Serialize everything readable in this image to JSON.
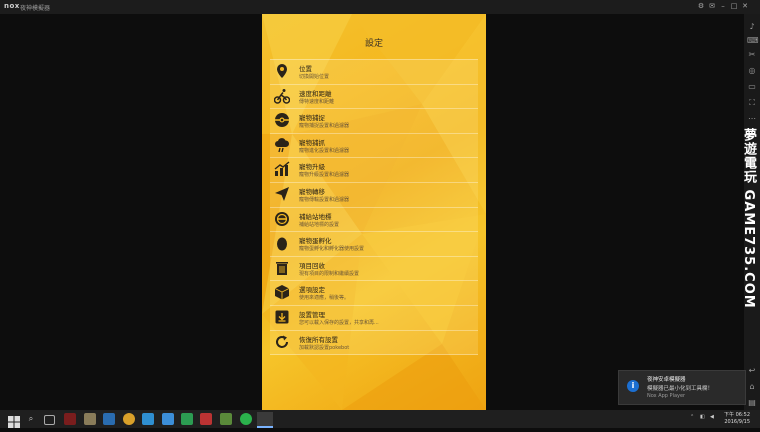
{
  "window": {
    "logo": "nox",
    "title": "夜神模擬器"
  },
  "settings": {
    "title": "設定",
    "items": [
      {
        "title": "位置",
        "subtitle": "切換開始位置",
        "icon": "map-pin-icon"
      },
      {
        "title": "速度和距離",
        "subtitle": "傳特速度和距離",
        "icon": "cyclist-icon"
      },
      {
        "title": "寵物捕捉",
        "subtitle": "寵物捕捉設置和過濾器",
        "icon": "pokeball-icon"
      },
      {
        "title": "寵物捕抓",
        "subtitle": "寵物進化設置和過濾器",
        "icon": "cloud-icon"
      },
      {
        "title": "寵物升級",
        "subtitle": "寵物升級設置和過濾器",
        "icon": "trend-up-icon"
      },
      {
        "title": "寵物轉移",
        "subtitle": "寵物傳輸設置和過濾器",
        "icon": "paper-plane-icon"
      },
      {
        "title": "補給站地標",
        "subtitle": "補給站地標的設置",
        "icon": "pokestop-icon"
      },
      {
        "title": "寵物蛋孵化",
        "subtitle": "寵物蛋孵化和孵化器使用設置",
        "icon": "egg-icon"
      },
      {
        "title": "項目回收",
        "subtitle": "現有項目的限制和繼續設置",
        "icon": "trash-icon"
      },
      {
        "title": "選項設定",
        "subtitle": "使用來適應，稍後等。",
        "icon": "box-icon"
      },
      {
        "title": "設置管理",
        "subtitle": "您可以載入保存的設置，共享和再...",
        "icon": "download-icon"
      },
      {
        "title": "恢復所有設置",
        "subtitle": "加載默認設置pokebot",
        "icon": "refresh-icon"
      }
    ]
  },
  "watermark": "夢遊電玩 GAME735.COM",
  "notification": {
    "title": "夜神安卓模擬器",
    "message": "模擬器已最小化到工具欄！",
    "source": "Nox App Player"
  },
  "clock": {
    "time": "下午 06:52",
    "date": "2016/9/15"
  }
}
